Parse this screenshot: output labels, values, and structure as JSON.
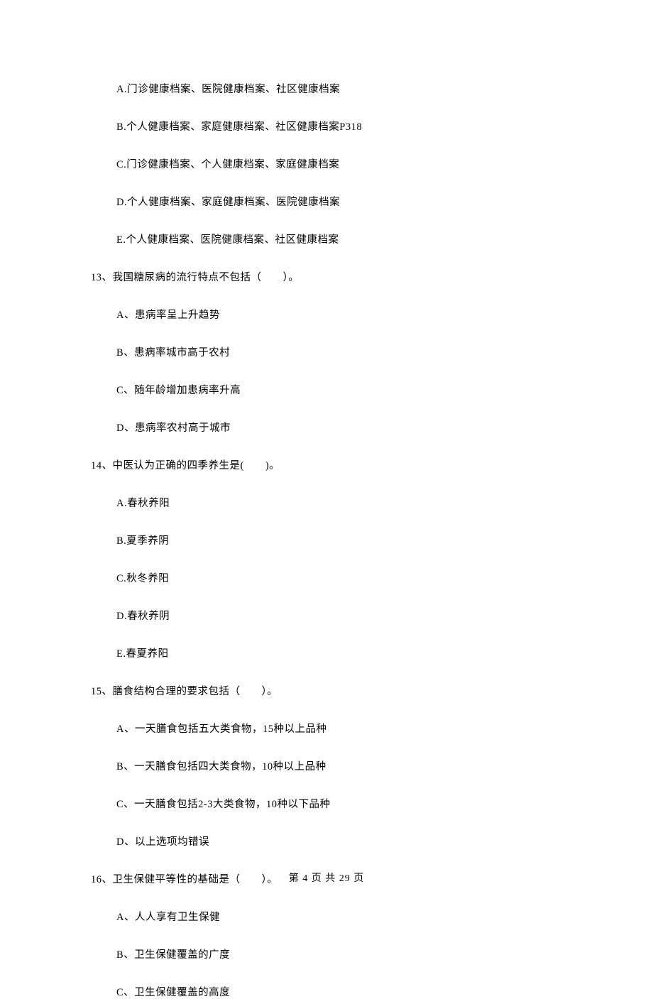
{
  "q12_options": {
    "a": "A.门诊健康档案、医院健康档案、社区健康档案",
    "b": "B.个人健康档案、家庭健康档案、社区健康档案P318",
    "c": "C.门诊健康档案、个人健康档案、家庭健康档案",
    "d": "D.个人健康档案、家庭健康档案、医院健康档案",
    "e": "E.个人健康档案、医院健康档案、社区健康档案"
  },
  "q13": {
    "stem": "13、我国糖尿病的流行特点不包括（　　）。",
    "a": "A、患病率呈上升趋势",
    "b": "B、患病率城市高于农村",
    "c": "C、随年龄增加患病率升高",
    "d": "D、患病率农村高于城市"
  },
  "q14": {
    "stem": "14、中医认为正确的四季养生是(　　)。",
    "a": "A.春秋养阳",
    "b": "B.夏季养阴",
    "c": "C.秋冬养阳",
    "d": "D.春秋养阴",
    "e": "E.春夏养阳"
  },
  "q15": {
    "stem": "15、膳食结构合理的要求包括（　　）。",
    "a": "A、一天膳食包括五大类食物，15种以上品种",
    "b": "B、一天膳食包括四大类食物，10种以上品种",
    "c": "C、一天膳食包括2-3大类食物，10种以下品种",
    "d": "D、以上选项均错误"
  },
  "q16": {
    "stem": "16、卫生保健平等性的基础是（　　）。",
    "a": "A、人人享有卫生保健",
    "b": "B、卫生保健覆盖的广度",
    "c": "C、卫生保健覆盖的高度"
  },
  "footer": "第 4 页 共 29 页"
}
